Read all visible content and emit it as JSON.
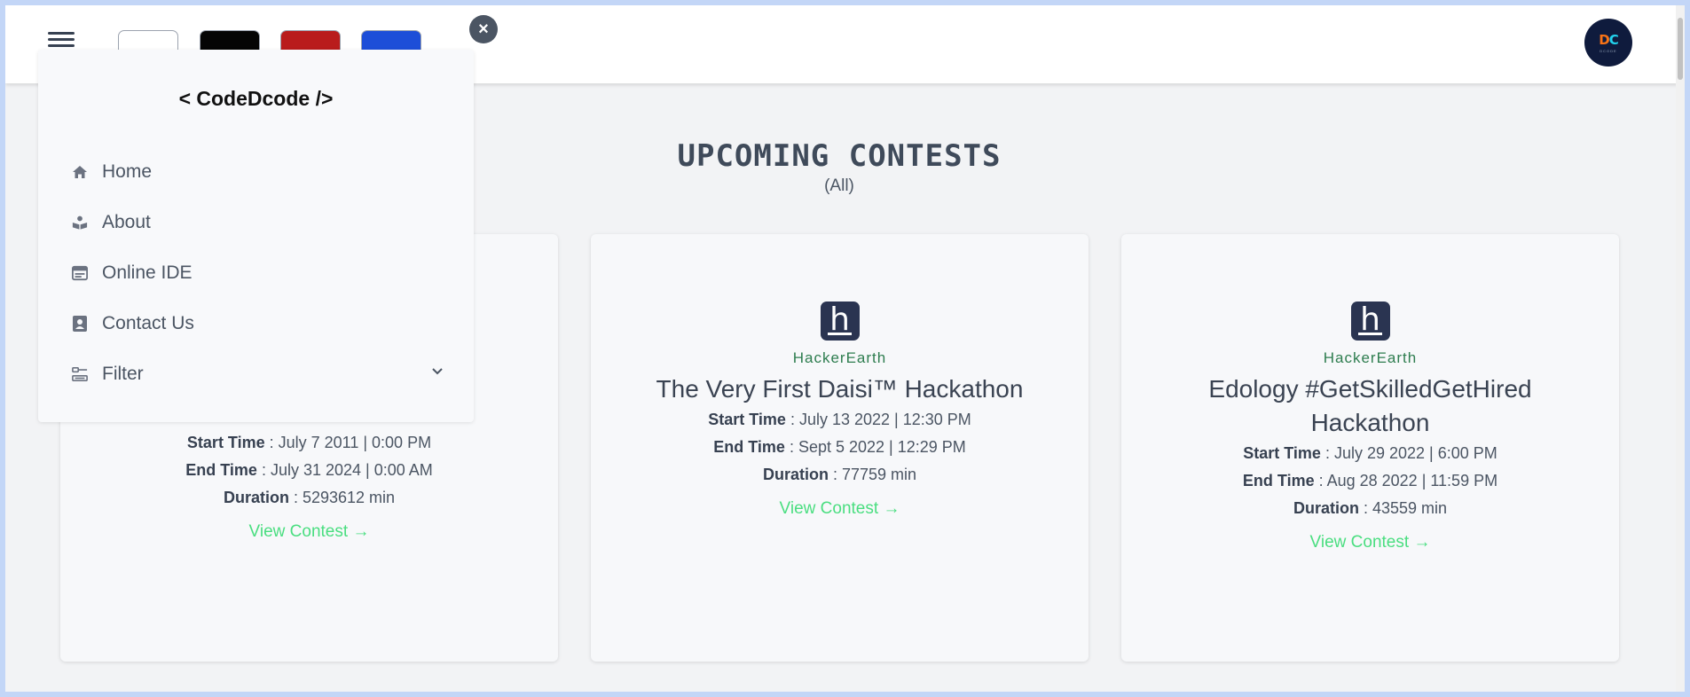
{
  "header": {
    "menu_icon": "hamburger-icon",
    "theme_swatches": [
      {
        "name": "white",
        "color": "#ffffff"
      },
      {
        "name": "black",
        "color": "#050505"
      },
      {
        "name": "red",
        "color": "#b91c1c"
      },
      {
        "name": "blue",
        "color": "#1d4ed8"
      }
    ],
    "avatar_text_d": "D",
    "avatar_text_c": "C",
    "avatar_sub": "DCODE"
  },
  "drawer": {
    "brand": "< CodeDcode />",
    "close_label": "×",
    "items": [
      {
        "label": "Home",
        "icon": "home-icon"
      },
      {
        "label": "About",
        "icon": "about-icon"
      },
      {
        "label": "Online IDE",
        "icon": "ide-icon"
      },
      {
        "label": "Contact Us",
        "icon": "contact-icon"
      },
      {
        "label": "Filter",
        "icon": "filter-icon"
      }
    ]
  },
  "main": {
    "heading": "UPCOMING CONTESTS",
    "subheading": "(All)"
  },
  "labels": {
    "start": "Start Time",
    "end": "End Time",
    "duration": "Duration",
    "view": "View Contest"
  },
  "contests": [
    {
      "platform": "",
      "title": "",
      "start": " : July 7 2011 | 0:00 PM",
      "end": " : July 31 2024 | 0:00 AM",
      "duration": " : 5293612 min"
    },
    {
      "platform": "HackerEarth",
      "title": "The Very First Daisi™ Hackathon",
      "start": " : July 13 2022 | 12:30 PM",
      "end": " : Sept 5 2022 | 12:29 PM",
      "duration": " : 77759 min"
    },
    {
      "platform": "HackerEarth",
      "title": "Edology #GetSkilledGetHired Hackathon",
      "start": " : July 29 2022 | 6:00 PM",
      "end": " : Aug 28 2022 | 11:59 PM",
      "duration": " : 43559 min"
    }
  ],
  "colors": {
    "accent_link": "#4ade80",
    "platform": "#2e7d4f",
    "logo_bg": "#2a3451"
  }
}
